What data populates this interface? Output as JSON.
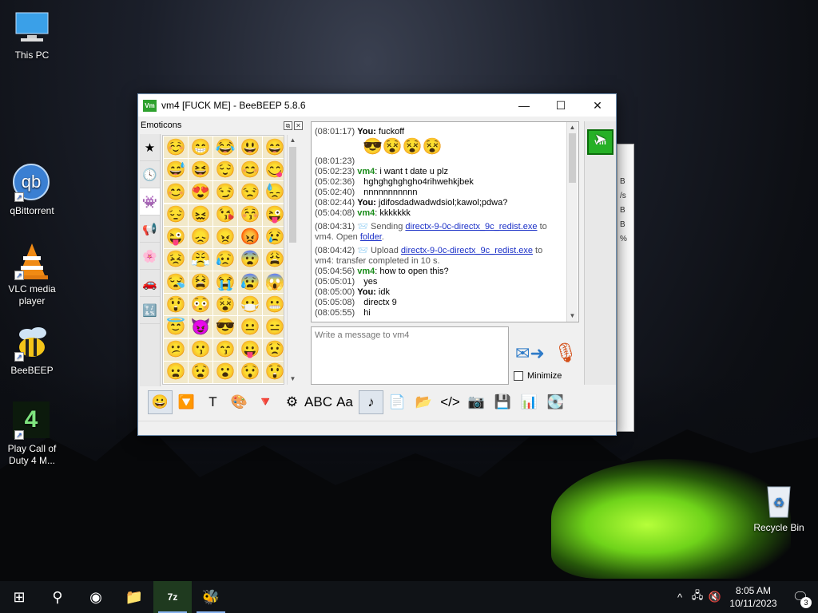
{
  "desktop": {
    "icons": [
      {
        "label": "This PC",
        "icon": "computer-icon"
      },
      {
        "label": "qBittorrent",
        "icon": "qbittorrent-icon",
        "glyph": "qb"
      },
      {
        "label": "VLC media player",
        "icon": "vlc-cone-icon"
      },
      {
        "label": "BeeBEEP",
        "icon": "bee-icon"
      },
      {
        "label": "Play Call of Duty 4 M...",
        "icon": "cod4-icon",
        "glyph": "4"
      },
      {
        "label": "Recycle Bin",
        "icon": "recycle-bin-icon"
      }
    ]
  },
  "window": {
    "title": "vm4 [FUCK ME] - BeeBEEP 5.8.6",
    "app_icon_text": "Vm",
    "controls": {
      "minimize": "—",
      "maximize": "☐",
      "close": "✕"
    }
  },
  "emoticons_panel": {
    "title": "Emoticons",
    "tabs": [
      "★",
      "🕓",
      "👾",
      "📢",
      "🌸",
      "🚗",
      "🔣"
    ],
    "selected_tab": 2,
    "grid": [
      "☺️",
      "😁",
      "😂",
      "😃",
      "😄",
      "😅",
      "😆",
      "😌",
      "😊",
      "😋",
      "😊",
      "😍",
      "😏",
      "😒",
      "😓",
      "😔",
      "😖",
      "😘",
      "😚",
      "😜",
      "😜",
      "😞",
      "😠",
      "😡",
      "😢",
      "😣",
      "😤",
      "😥",
      "😨",
      "😩",
      "😪",
      "😫",
      "😭",
      "😰",
      "😱",
      "😲",
      "😳",
      "😵",
      "😷",
      "😬",
      "😇",
      "😈",
      "😎",
      "😐",
      "😑",
      "😕",
      "😗",
      "😙",
      "😛",
      "😟",
      "😦",
      "😧",
      "😮",
      "😯",
      "😲"
    ],
    "close_glyph": "✕",
    "float_glyph": "⧉"
  },
  "chat": {
    "messages": [
      {
        "time": "(08:01:17)",
        "sender": "You:",
        "sender_type": "you",
        "text": "fuckoff"
      },
      {
        "time": "(08:01:23)",
        "sender": "",
        "sender_type": "emoji",
        "text": "😎😵😵😵"
      },
      {
        "time": "(05:02:23)",
        "sender": "vm4",
        "sender_type": "vm",
        "text": ": i want t date u plz"
      },
      {
        "time": "(05:02:36)",
        "sender": "",
        "sender_type": "none",
        "text": "hghghghghgho4rihwehkjbek"
      },
      {
        "time": "(05:02:40)",
        "sender": "",
        "sender_type": "none",
        "text": "nnnnnnnnnnn"
      },
      {
        "time": "(08:02:44)",
        "sender": "You:",
        "sender_type": "you",
        "text": "jdifosdadwadwdsiol;kawol;pdwa?"
      },
      {
        "time": "(05:04:08)",
        "sender": "vm4",
        "sender_type": "vm",
        "text": ": kkkkkkk"
      }
    ],
    "transfer1": {
      "time": "(08:04:31)",
      "prefix": "Sending",
      "file": "directx-9-0c-directx_9c_redist.exe",
      "to": "to",
      "line2_a": "vm4. Open",
      "folder": "folder",
      "line2_b": "."
    },
    "transfer2": {
      "time": "(08:04:42)",
      "prefix": "Upload",
      "file": "directx-9-0c-directx_9c_redist.exe",
      "to": "to",
      "line2": "vm4: transfer completed in 10 s."
    },
    "messages2": [
      {
        "time": "(05:04:56)",
        "sender": "vm4",
        "sender_type": "vm",
        "text": ": how to open this?"
      },
      {
        "time": "(05:05:01)",
        "sender": "",
        "sender_type": "none",
        "text": "yes"
      },
      {
        "time": "(08:05:00)",
        "sender": "You:",
        "sender_type": "you",
        "text": "idk"
      },
      {
        "time": "(05:05:08)",
        "sender": "",
        "sender_type": "none",
        "text": "directx 9"
      },
      {
        "time": "(08:05:55)",
        "sender": "",
        "sender_type": "none",
        "text": "hi"
      }
    ]
  },
  "composer": {
    "placeholder": "Write a message to vm4",
    "minimize_label": "Minimize"
  },
  "user_strip": {
    "button_text": "vm"
  },
  "toolbar": [
    "😀",
    "🔽",
    "T",
    "🎨",
    "🔻",
    "⚙",
    "ABC",
    "Aa",
    "♪",
    "📄",
    "📂",
    "</>",
    "📷",
    "💾",
    "📊",
    "💽"
  ],
  "bg_window_text": [
    "B",
    "/s",
    "B",
    "B",
    "%"
  ],
  "taskbar": {
    "items": [
      {
        "name": "start-button",
        "glyph": "⊞"
      },
      {
        "name": "search-button",
        "glyph": "⚲"
      },
      {
        "name": "chrome-app",
        "glyph": "◉"
      },
      {
        "name": "file-explorer-app",
        "glyph": "📁"
      },
      {
        "name": "7zip-app",
        "glyph": "7z"
      },
      {
        "name": "beebeep-app",
        "glyph": "🐝"
      }
    ],
    "clock_time": "8:05 AM",
    "clock_date": "10/11/2023",
    "notification_count": "3",
    "colors": {
      "taskbar": "#101317",
      "accent": "#8ab4f0"
    }
  }
}
